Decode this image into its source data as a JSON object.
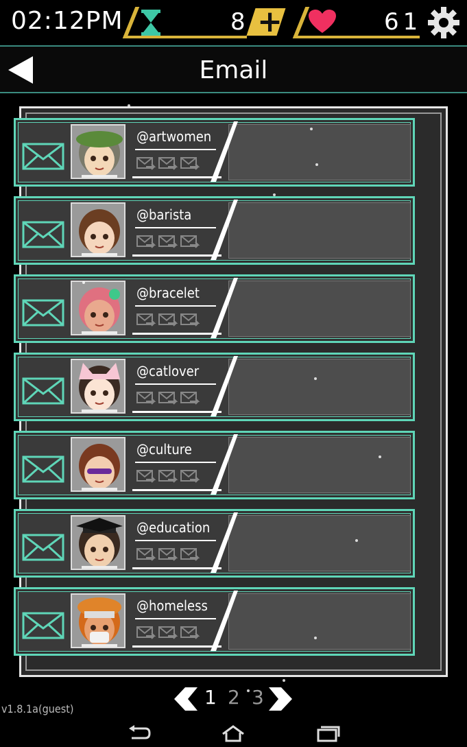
{
  "status": {
    "time": "02:12PM",
    "hourglass_count": "8",
    "heart_count": "61"
  },
  "header": {
    "title": "Email"
  },
  "emails": [
    {
      "handle": "@artwomen",
      "avatar": "artwomen"
    },
    {
      "handle": "@barista",
      "avatar": "barista"
    },
    {
      "handle": "@bracelet",
      "avatar": "bracelet"
    },
    {
      "handle": "@catlover",
      "avatar": "catlover"
    },
    {
      "handle": "@culture",
      "avatar": "culture"
    },
    {
      "handle": "@education",
      "avatar": "education"
    },
    {
      "handle": "@homeless",
      "avatar": "homeless"
    }
  ],
  "pagination": {
    "page1": "1",
    "page2": "2",
    "page3": "3",
    "current": 1
  },
  "version": "v1.8.1a(guest)",
  "colors": {
    "accent": "#5fd6b8",
    "gold": "#d9b43a",
    "heart": "#f03060",
    "panel": "#2b2b2b"
  },
  "icons": [
    "hourglass-icon",
    "plus-icon",
    "heart-icon",
    "gear-icon",
    "back-arrow-icon",
    "envelope-icon",
    "forward-mail-icon",
    "prev-page-icon",
    "next-page-icon",
    "nav-back-icon",
    "nav-home-icon",
    "nav-recents-icon"
  ]
}
